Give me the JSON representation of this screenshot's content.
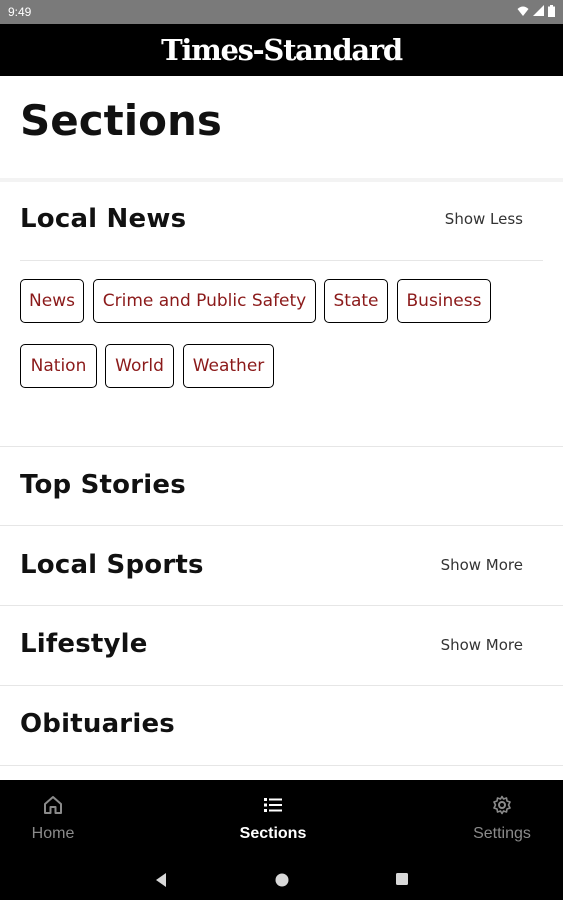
{
  "status_bar": {
    "time": "9:49"
  },
  "header": {
    "masthead": "Times-Standard"
  },
  "page": {
    "title": "Sections"
  },
  "local_news": {
    "title": "Local News",
    "action": "Show Less",
    "chips": [
      "News",
      "Crime and Public Safety",
      "State",
      "Business",
      "Nation",
      "World",
      "Weather"
    ]
  },
  "sections": [
    {
      "title": "Top Stories",
      "action": ""
    },
    {
      "title": "Local Sports",
      "action": "Show More"
    },
    {
      "title": "Lifestyle",
      "action": "Show More"
    },
    {
      "title": "Obituaries",
      "action": ""
    }
  ],
  "bottom_nav": {
    "items": [
      {
        "label": "Home",
        "icon": "home-icon"
      },
      {
        "label": "Sections",
        "icon": "list-icon"
      },
      {
        "label": "Settings",
        "icon": "gear-icon"
      }
    ],
    "active": "Sections"
  },
  "colors": {
    "chip_text": "#8b1a1a",
    "header_bg": "#000000"
  }
}
